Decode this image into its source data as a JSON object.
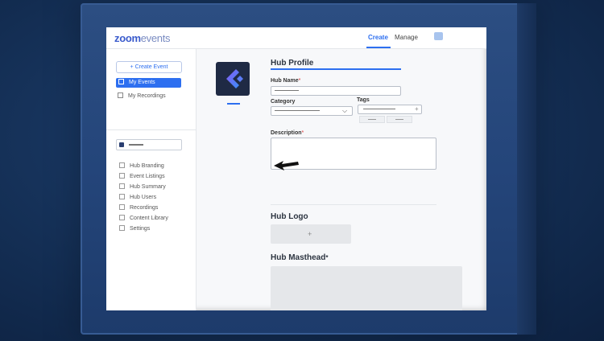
{
  "app": {
    "logo_primary": "zoom",
    "logo_secondary": "events"
  },
  "nav": {
    "create_label": "Create",
    "manage_label": "Manage",
    "avatar_icon": "avatar-square"
  },
  "sidebar": {
    "create_button": "+ Create Event",
    "items": [
      {
        "label": "My Events",
        "active": true
      },
      {
        "label": "My Recordings",
        "active": false
      }
    ],
    "hub_selector_icon": "hub-avatar",
    "hub_items": [
      {
        "label": "Hub Branding"
      },
      {
        "label": "Event Listings"
      },
      {
        "label": "Hub Summary"
      },
      {
        "label": "Hub Users"
      },
      {
        "label": "Recordings"
      },
      {
        "label": "Content Library"
      },
      {
        "label": "Settings"
      }
    ]
  },
  "main": {
    "profile_title": "Hub Profile",
    "hub_name_label": "Hub Name",
    "category_label": "Category",
    "tags_label": "Tags",
    "description_label": "Description",
    "required_mark": "*",
    "hub_logo_title": "Hub Logo",
    "hub_masthead_title": "Hub Masthead",
    "upload_plus": "+",
    "tags_plus": "+",
    "category_chevron": "⌵"
  },
  "colors": {
    "accent": "#2d6ff0",
    "hub_logo_bg": "#1f2a44",
    "frame": "#24457a"
  }
}
